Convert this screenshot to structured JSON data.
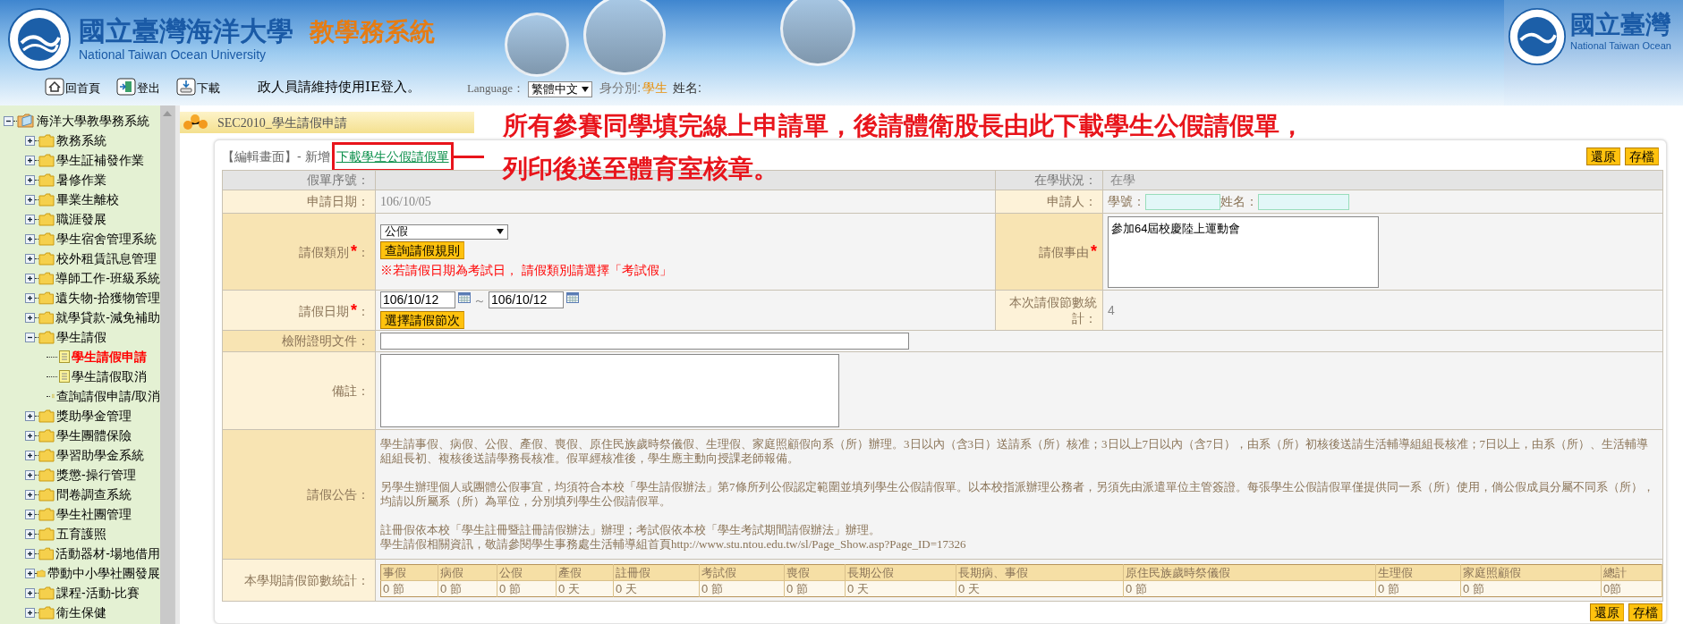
{
  "header": {
    "university_name": "國立臺灣海洋大學",
    "university_name_en": "National Taiwan Ocean University",
    "system_name": "教學務系統",
    "repeat_name": "國立臺灣",
    "repeat_name_en": "National Taiwan Ocean"
  },
  "toolbar": {
    "buttons": [
      {
        "label": "回首頁",
        "kind": "home"
      },
      {
        "label": "登出",
        "kind": "logout"
      },
      {
        "label": "下載",
        "kind": "download"
      }
    ],
    "notice": "政人員請維持使用IE登入。",
    "language_label": "Language：",
    "language": "繁體中文",
    "identity_label": "身分別:",
    "identity": "學生",
    "name_label": "姓名:"
  },
  "sidebar": {
    "root": {
      "label": "海洋大學教學務系統",
      "kind": "root",
      "expanded": true,
      "children": [
        {
          "label": "教務系統",
          "kind": "folder",
          "expanded": false
        },
        {
          "label": "學生証補發作業",
          "kind": "folder",
          "expanded": false
        },
        {
          "label": "暑修作業",
          "kind": "folder",
          "expanded": false
        },
        {
          "label": "畢業生離校",
          "kind": "folder",
          "expanded": false
        },
        {
          "label": "職涯發展",
          "kind": "folder",
          "expanded": false
        },
        {
          "label": "學生宿舍管理系統",
          "kind": "folder",
          "expanded": false
        },
        {
          "label": "校外租賃訊息管理",
          "kind": "folder",
          "expanded": false
        },
        {
          "label": "導師工作-班級系統",
          "kind": "folder",
          "expanded": false
        },
        {
          "label": "遺失物-拾獲物管理",
          "kind": "folder",
          "expanded": false
        },
        {
          "label": "就學貸款-減免補助",
          "kind": "folder",
          "expanded": false
        },
        {
          "label": "學生請假",
          "kind": "folder",
          "expanded": true,
          "children": [
            {
              "label": "學生請假申請",
              "kind": "page",
              "selected": true
            },
            {
              "label": "學生請假取消",
              "kind": "page",
              "selected": false
            },
            {
              "label": "查詢請假申請/取消",
              "kind": "page",
              "selected": false
            }
          ]
        },
        {
          "label": "獎助學金管理",
          "kind": "folder",
          "expanded": false
        },
        {
          "label": "學生團體保險",
          "kind": "folder",
          "expanded": false
        },
        {
          "label": "學習助學金系統",
          "kind": "folder",
          "expanded": false
        },
        {
          "label": "獎懲-操行管理",
          "kind": "folder",
          "expanded": false
        },
        {
          "label": "問卷調查系統",
          "kind": "folder",
          "expanded": false
        },
        {
          "label": "學生社團管理",
          "kind": "folder",
          "expanded": false
        },
        {
          "label": "五育護照",
          "kind": "folder",
          "expanded": false
        },
        {
          "label": "活動器材-場地借用",
          "kind": "folder",
          "expanded": false
        },
        {
          "label": "帶動中小學社團發展",
          "kind": "folder",
          "expanded": false
        },
        {
          "label": "課程-活動-比賽",
          "kind": "folder",
          "expanded": false
        },
        {
          "label": "衛生保健",
          "kind": "folder",
          "expanded": false
        }
      ]
    }
  },
  "page_title": "SEC2010_學生請假申請",
  "annotation": {
    "lines": [
      "所有參賽同學填完線上申請單，後請體衛股長由此下載學生公假請假單，",
      "列印後送至體育室核章。"
    ]
  },
  "form": {
    "mode_label": "【編輯畫面】- 新增",
    "download_link": "下載學生公假請假單",
    "buttons": [
      "還原",
      "存檔"
    ],
    "serial": {
      "label": "假單序號",
      "colon": "："
    },
    "status": {
      "label": "在學狀況",
      "colon": "：",
      "value": "在學"
    },
    "apply_date": {
      "label": "申請日期：",
      "value": "106/10/05"
    },
    "applicant": {
      "label": "申請人：",
      "student_id_label": "學號：",
      "name_label": "姓名："
    },
    "leave_type": {
      "label": "請假類別",
      "required_mark": "*",
      "colon": "：",
      "value": "公假",
      "rules_button": "查詢請假規則",
      "warning": "※若請假日期為考試日， 請假類別請選擇「考試假」"
    },
    "reason": {
      "label": "請假事由",
      "required_mark": "*",
      "value": "參加64屆校慶陸上運動會"
    },
    "leave_dates": {
      "label": "請假日期",
      "required_mark": "*",
      "colon": "：",
      "start": "106/10/12",
      "separator": "～",
      "end": "106/10/12",
      "periods_button": "選擇請假節次"
    },
    "period_count": {
      "label": "本次請假節數統計：",
      "value": "4"
    },
    "attachment": {
      "label": "檢附證明文件："
    },
    "remarks": {
      "label": "備註："
    },
    "notice": {
      "label": "請假公告：",
      "paragraphs": [
        [
          "學生請事假、病假、公假、產假、喪假、原住民族歲時祭儀假、生理假、家庭照顧假向系（所）辦理。3日以內（含3日）送請系（所）核准；3日以上7日以內（含7日），由系（所）初核後送請生活輔導組組長核准；7日以上，由系（所）、生活輔導組組長初、複核後送請學務長核准。假單經核准後，學生應主動向授課老師報備。"
        ],
        [
          "另學生辦理個人或團體公假事宜，均須符合本校「學生請假辦法」第7條所列公假認定範圍並填列學生公假請假單。以本校指派辦理公務者，另須先由派遣單位主管簽證。每張學生公假請假單僅提供同一系（所）使用，倘公假成員分屬不同系（所），均請以所屬系（所）為單位，分別填列學生公假請假單。"
        ],
        [
          "註冊假依本校「學生註冊暨註冊請假辦法」辦理；考試假依本校「學生考試期間請假辦法」辦理。",
          "學生請假相關資訊，敬請參閱學生事務處生活輔導組首頁http://www.stu.ntou.edu.tw/sl/Page_Show.asp?Page_ID=17326"
        ]
      ]
    },
    "semester_stats": {
      "label": "本學期請假節數統計：",
      "columns": [
        {
          "label": "事假",
          "value": "0 節"
        },
        {
          "label": "病假",
          "value": "0 節"
        },
        {
          "label": "公假",
          "value": "0 節"
        },
        {
          "label": "產假",
          "value": "0 天"
        },
        {
          "label": "註冊假",
          "value": "0 天"
        },
        {
          "label": "考試假",
          "value": "0 節"
        },
        {
          "label": "喪假",
          "value": "0 節"
        },
        {
          "label": "長期公假",
          "value": "0 天"
        },
        {
          "label": "長期病、事假",
          "value": "0 天"
        },
        {
          "label": "原住民族歲時祭儀假",
          "value": "0 節"
        },
        {
          "label": "生理假",
          "value": "0 節"
        },
        {
          "label": "家庭照顧假",
          "value": "0 節"
        },
        {
          "label": "總計",
          "value": "0節"
        }
      ]
    },
    "bottom_buttons": [
      "還原",
      "存檔"
    ]
  }
}
